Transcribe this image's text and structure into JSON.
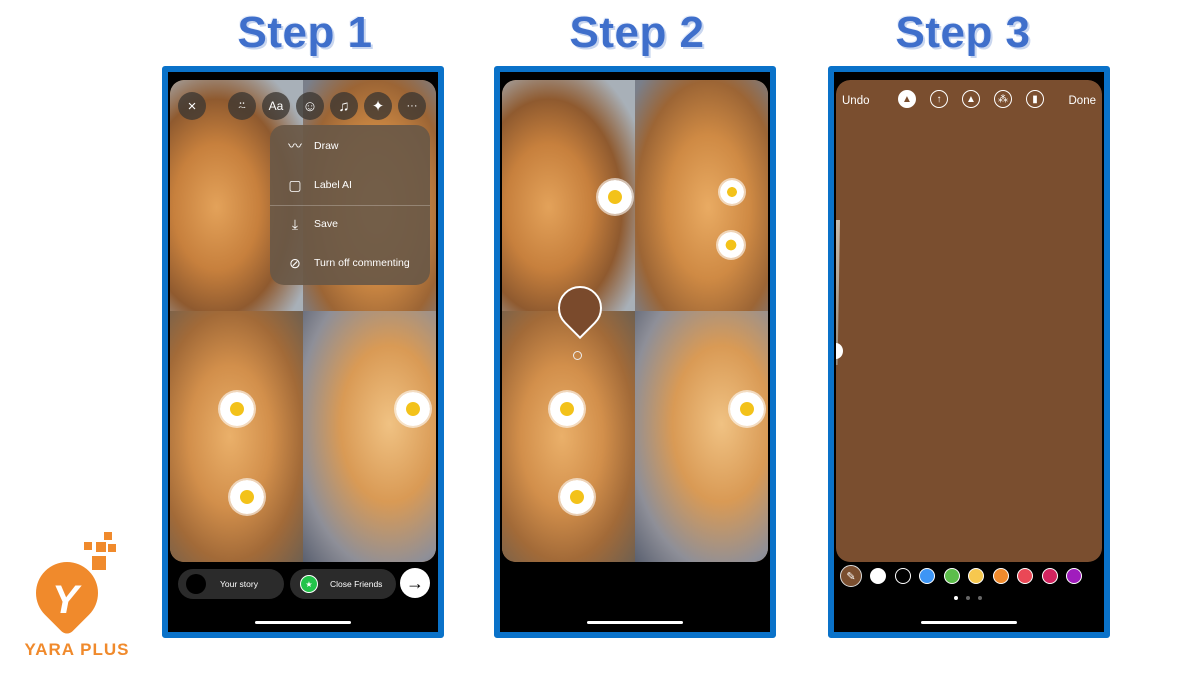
{
  "steps": [
    {
      "title": "Step 1"
    },
    {
      "title": "Step 2"
    },
    {
      "title": "Step 3"
    }
  ],
  "step1": {
    "toolbar": {
      "close_icon": "×",
      "tag_icon": "⍨",
      "text_icon": "Aa",
      "sticker_icon": "☺",
      "music_icon": "♫",
      "effects_icon": "✦",
      "more_icon": "···"
    },
    "menu": [
      {
        "icon": "〰",
        "label": "Draw"
      },
      {
        "icon": "▢",
        "label": "Label AI"
      },
      {
        "icon": "⤓",
        "label": "Save"
      },
      {
        "icon": "⊘",
        "label": "Turn off commenting"
      }
    ],
    "share": {
      "your_story": "Your story",
      "close_friends": "Close Friends",
      "close_friends_icon": "★",
      "next_icon": "→"
    }
  },
  "step3": {
    "undo": "Undo",
    "done": "Done",
    "tools": [
      {
        "name": "pen",
        "glyph": "▲"
      },
      {
        "name": "arrow",
        "glyph": "↑"
      },
      {
        "name": "marker",
        "glyph": "▲"
      },
      {
        "name": "glow",
        "glyph": "⁂"
      },
      {
        "name": "eraser",
        "glyph": "▮"
      }
    ],
    "selected_color": "#7a4e2f",
    "eyedropper_icon": "✎",
    "palette": [
      "#ffffff",
      "#000000",
      "#3d95f5",
      "#5cbd4b",
      "#f7c84f",
      "#f08a2c",
      "#ea4856",
      "#d1245f",
      "#a01dbd"
    ],
    "page_count": 3,
    "active_page": 1,
    "brush_size": 0.1
  },
  "logo": {
    "text": "YARA PLUS",
    "mark": "Y",
    "color": "#f08a2c"
  },
  "accent": "#0a72c9"
}
